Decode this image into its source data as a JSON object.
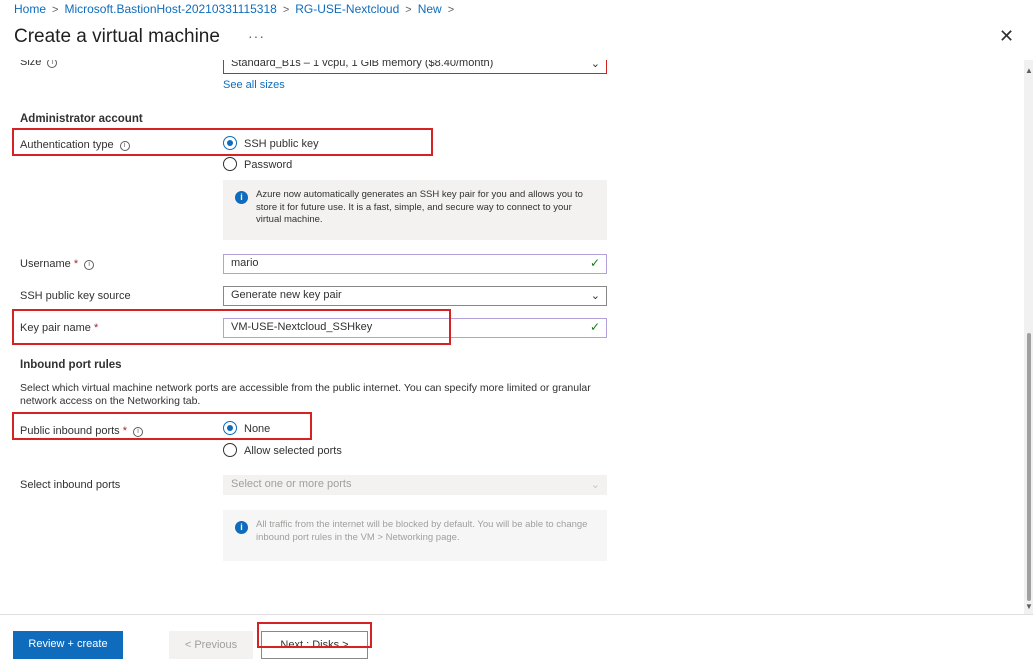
{
  "breadcrumb": [
    "Home",
    "Microsoft.BastionHost-20210331115318",
    "RG-USE-Nextcloud",
    "New"
  ],
  "page": {
    "title": "Create a virtual machine",
    "more": "···",
    "close": "✕"
  },
  "size": {
    "label": "Size",
    "value": "Standard_B1s – 1 vcpu, 1 GiB memory ($8.40/month)",
    "see_all": "See all sizes"
  },
  "admin": {
    "heading": "Administrator account",
    "auth_label": "Authentication type",
    "auth_options": [
      "SSH public key",
      "Password"
    ],
    "auth_selected": "SSH public key",
    "ssh_info": "Azure now automatically generates an SSH key pair for you and allows you to store it for future use. It is a fast, simple, and secure way to connect to your virtual machine.",
    "username_label": "Username",
    "username_value": "mario",
    "key_source_label": "SSH public key source",
    "key_source_value": "Generate new key pair",
    "key_name_label": "Key pair name",
    "key_name_value": "VM-USE-Nextcloud_SSHkey"
  },
  "inbound": {
    "heading": "Inbound port rules",
    "description": "Select which virtual machine network ports are accessible from the public internet. You can specify more limited or granular network access on the Networking tab.",
    "public_label": "Public inbound ports",
    "public_options": [
      "None",
      "Allow selected ports"
    ],
    "public_selected": "None",
    "select_label": "Select inbound ports",
    "select_placeholder": "Select one or more ports",
    "info": "All traffic from the internet will be blocked by default. You will be able to change inbound port rules in the VM > Networking page."
  },
  "footer": {
    "review": "Review + create",
    "previous": "< Previous",
    "next": "Next : Disks >"
  },
  "colors": {
    "accent": "#0f6cbd",
    "highlight": "#d52222",
    "valid": "#107c10",
    "required": "#a4262c"
  },
  "icons": {
    "info": "info-circle-icon",
    "check": "checkmark-icon",
    "chevron": "chevron-down-icon",
    "close": "close-icon"
  }
}
